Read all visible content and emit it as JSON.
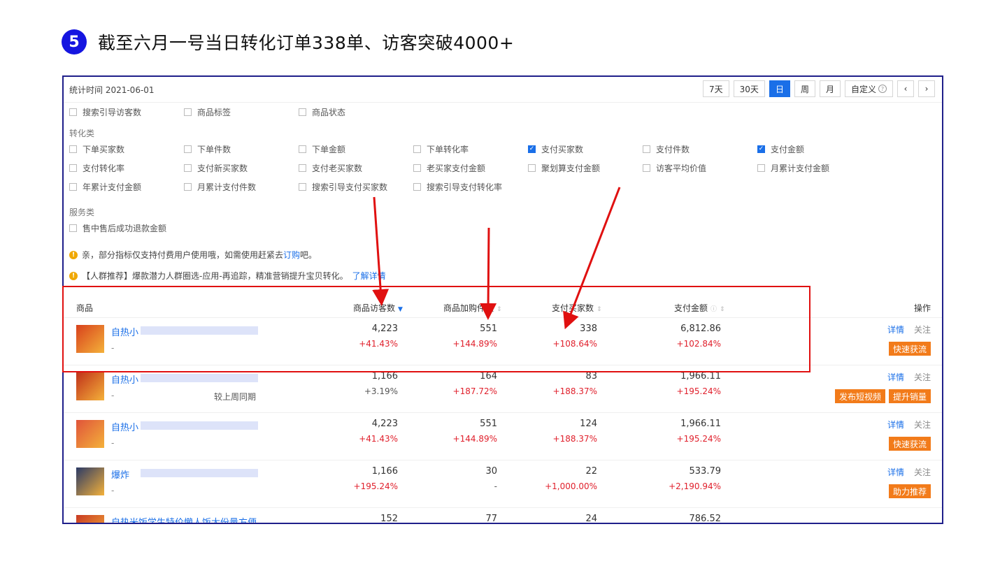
{
  "headline": {
    "number": "5",
    "text": "截至六月一号当日转化订单338单、访客突破4000+"
  },
  "topbar": {
    "stat_time": "统计时间 2021-06-01",
    "ranges": [
      "7天",
      "30天",
      "日",
      "周",
      "月",
      "自定义"
    ],
    "active_range": "日",
    "custom_icon": "question-icon",
    "prev": "‹",
    "next": "›"
  },
  "metrics": {
    "row0": [
      {
        "label": "搜索引导访客数",
        "checked": false
      },
      {
        "label": "商品标签",
        "checked": false
      },
      {
        "label": "商品状态",
        "checked": false
      }
    ],
    "conversion_label": "转化类",
    "conversion": [
      [
        {
          "label": "下单买家数",
          "checked": false
        },
        {
          "label": "下单件数",
          "checked": false
        },
        {
          "label": "下单金额",
          "checked": false
        },
        {
          "label": "下单转化率",
          "checked": false
        },
        {
          "label": "支付买家数",
          "checked": true
        },
        {
          "label": "支付件数",
          "checked": false
        },
        {
          "label": "支付金额",
          "checked": true
        }
      ],
      [
        {
          "label": "支付转化率",
          "checked": false
        },
        {
          "label": "支付新买家数",
          "checked": false
        },
        {
          "label": "支付老买家数",
          "checked": false
        },
        {
          "label": "老买家支付金额",
          "checked": false
        },
        {
          "label": "聚划算支付金额",
          "checked": false
        },
        {
          "label": "访客平均价值",
          "checked": false
        },
        {
          "label": "月累计支付金额",
          "checked": false
        }
      ],
      [
        {
          "label": "年累计支付金额",
          "checked": false
        },
        {
          "label": "月累计支付件数",
          "checked": false
        },
        {
          "label": "搜索引导支付买家数",
          "checked": false
        },
        {
          "label": "搜索引导支付转化率",
          "checked": false
        }
      ]
    ],
    "service_label": "服务类",
    "service": [
      {
        "label": "售中售后成功退款金额",
        "checked": false
      }
    ]
  },
  "notices": {
    "n1_text": "亲，部分指标仅支持付费用户使用哦，如需使用赶紧去",
    "n1_link": "订购",
    "n1_tail": "吧。",
    "n2_text": "【人群推荐】爆款潜力人群圈选-应用-再追踪，精准营销提升宝贝转化。",
    "n2_link": "了解详情"
  },
  "table": {
    "headers": {
      "product": "商品",
      "visitors": "商品访客数",
      "cart": "商品加购件数",
      "buyers": "支付买家数",
      "amount": "支付金额",
      "ops": "操作"
    },
    "rows": [
      {
        "name": "自热小",
        "compare": "",
        "visitors": "4,223",
        "visitors_d": "+41.43%",
        "cart": "551",
        "cart_d": "+144.89%",
        "buyers": "338",
        "buyers_d": "+108.64%",
        "amount": "6,812.86",
        "amount_d": "+102.84%",
        "buttons": [
          "快速获流"
        ]
      },
      {
        "name": "自热小",
        "compare": "较上周同期",
        "visitors": "1,166",
        "visitors_d": "+3.19%",
        "cart": "164",
        "cart_d": "+187.72%",
        "buyers": "83",
        "buyers_d": "+188.37%",
        "amount": "1,966.11",
        "amount_d": "+195.24%",
        "buttons": [
          "发布短视频",
          "提升销量"
        ]
      },
      {
        "name": "自热小",
        "compare": "",
        "visitors": "4,223",
        "visitors_d": "+41.43%",
        "cart": "551",
        "cart_d": "+144.89%",
        "buyers": "124",
        "buyers_d": "+188.37%",
        "amount": "1,966.11",
        "amount_d": "+195.24%",
        "buttons": [
          "快速获流"
        ]
      },
      {
        "name": "爆炸",
        "compare": "",
        "visitors": "1,166",
        "visitors_d": "+195.24%",
        "cart": "30",
        "cart_d": "-",
        "buyers": "22",
        "buyers_d": "+1,000.00%",
        "amount": "533.79",
        "amount_d": "+2,190.94%",
        "buttons": [
          "助力推荐"
        ]
      },
      {
        "name": "自热米饭学生特价懒人饭大份量方便",
        "compare": "",
        "visitors": "152",
        "visitors_d": "",
        "cart": "77",
        "cart_d": "",
        "buyers": "24",
        "buyers_d": "",
        "amount": "786.52",
        "amount_d": "",
        "buttons": []
      }
    ],
    "detail_label": "详情",
    "follow_label": "关注",
    "dash": "-"
  },
  "colors": {
    "accent": "#1a6fe8",
    "up": "#e0202c",
    "button": "#f27b1a",
    "annotation": "#e01010"
  }
}
